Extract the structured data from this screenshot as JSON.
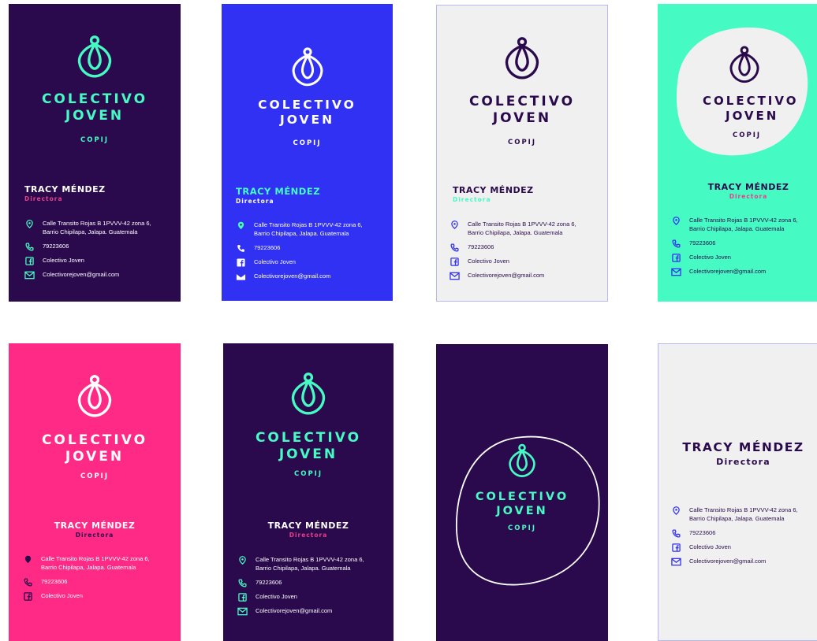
{
  "brand": {
    "line1": "COLECTIVO",
    "line2": "JOVEN",
    "acronym": "COPIJ"
  },
  "person": {
    "name": "TRACY MÉNDEZ",
    "role": "Directora"
  },
  "contact": {
    "address_line1": "Calle Transito Rojas B 1PVVV-42 zona 6,",
    "address_line2": "Barrio Chipilapa, Jalapa. Guatemala",
    "phone": "79223606",
    "facebook": "Colectivo Joven",
    "email": "Colectivorejoven@gmail.com"
  },
  "icons": [
    "location-pin-icon",
    "phone-icon",
    "facebook-icon",
    "mail-icon",
    "drop-logo-icon"
  ],
  "colors": {
    "deep_purple": "#2a0a4c",
    "royal_blue": "#3131f3",
    "light_gray": "#f0f0f0",
    "mint": "#46fbc3",
    "hot_pink": "#ff2a86",
    "pink_accent": "#e83e8c",
    "white": "#ffffff"
  }
}
